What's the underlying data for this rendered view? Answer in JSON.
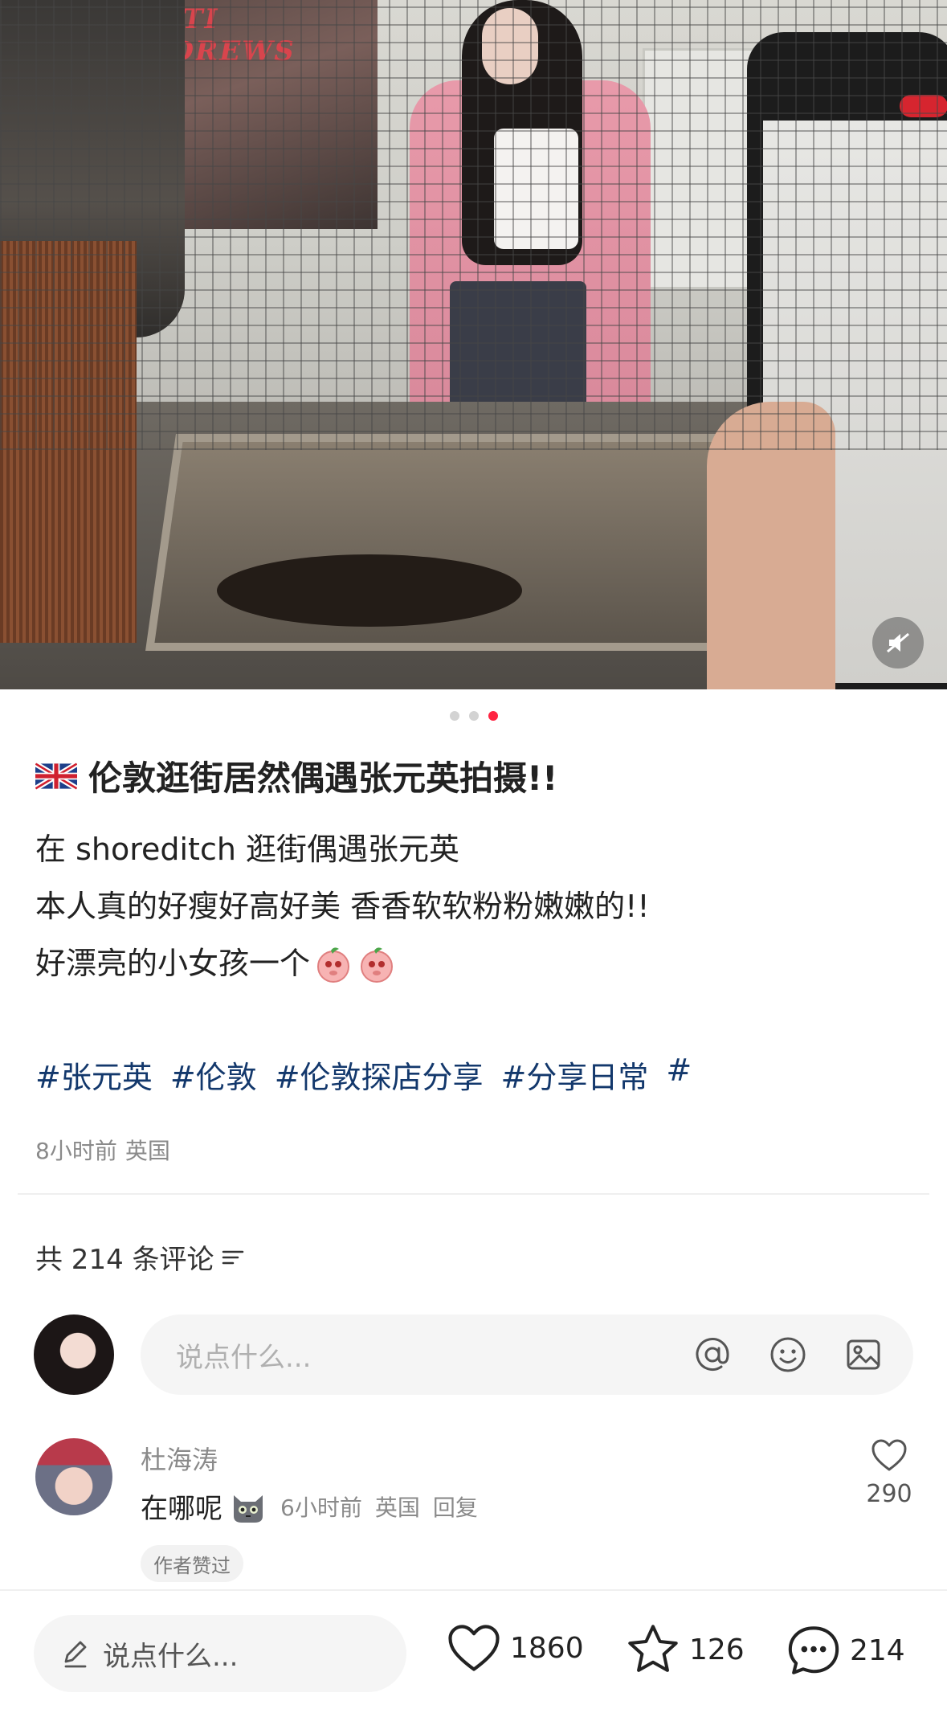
{
  "carousel": {
    "total": 3,
    "active_index": 2
  },
  "post": {
    "title": "伦敦逛街居然偶遇张元英拍摄!!",
    "body_lines": [
      "在 shoreditch 逛街偶遇张元英",
      "本人真的好瘦好高好美 香香软软粉粉嫩嫩的!!",
      "好漂亮的小女孩一个"
    ],
    "tags": [
      "#张元英",
      "#伦敦",
      "#伦敦探店分享",
      "#分享日常",
      "#"
    ],
    "time": "8小时前",
    "location": "英国"
  },
  "comments_section": {
    "count_label": "共 214 条评论",
    "input_placeholder": "说点什么..."
  },
  "comments": [
    {
      "author": "杜海涛",
      "text": "在哪呢",
      "time": "6小时前",
      "location": "英国",
      "reply_label": "回复",
      "likes": "290",
      "badge": "作者赞过"
    }
  ],
  "bottom_bar": {
    "input_placeholder": "说点什么...",
    "likes": "1860",
    "favorites": "126",
    "comments": "214"
  },
  "colors": {
    "accent": "#ff2442",
    "tag": "#13386c",
    "muted": "#8a8a8a"
  },
  "icons": [
    "mute-icon",
    "uk-flag-icon",
    "peach-emoji-icon",
    "sort-icon",
    "at-icon",
    "emoji-icon",
    "image-icon",
    "cat-emoji-icon",
    "heart-icon",
    "pencil-icon",
    "star-icon",
    "comment-bubble-icon"
  ]
}
